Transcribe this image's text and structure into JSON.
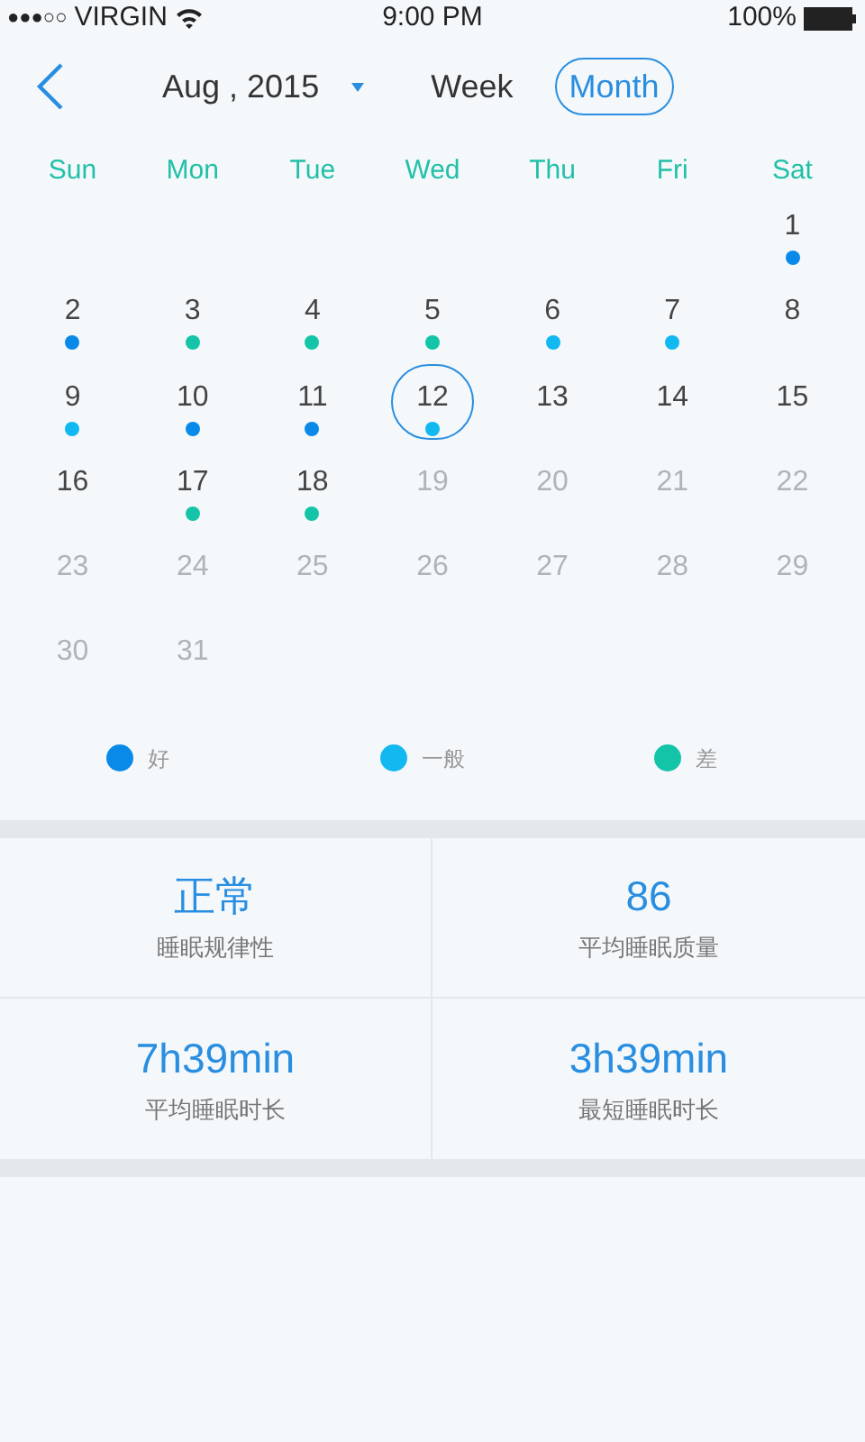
{
  "status_bar": {
    "signal": "●●●○○",
    "carrier": "VIRGIN",
    "time": "9:00 PM",
    "battery": "100%"
  },
  "header": {
    "month": "Aug , 2015",
    "tabs": [
      {
        "label": "Week",
        "selected": false
      },
      {
        "label": "Month",
        "selected": true
      }
    ]
  },
  "weekdays": [
    "Sun",
    "Mon",
    "Tue",
    "Wed",
    "Thu",
    "Fri",
    "Sat"
  ],
  "weeks": [
    [
      {
        "kind": "blank"
      },
      {
        "kind": "blank"
      },
      {
        "kind": "blank"
      },
      {
        "kind": "blank"
      },
      {
        "kind": "blank"
      },
      {
        "kind": "blank"
      },
      {
        "kind": "day",
        "day": "1",
        "muted": false,
        "selected": false,
        "color": "#0a8ae8"
      }
    ],
    [
      {
        "kind": "day",
        "day": "2",
        "muted": false,
        "selected": false,
        "color": "#0a8ae8"
      },
      {
        "kind": "day",
        "day": "3",
        "muted": false,
        "selected": false,
        "color": "#13c4a8"
      },
      {
        "kind": "day",
        "day": "4",
        "muted": false,
        "selected": false,
        "color": "#13c4a8"
      },
      {
        "kind": "day",
        "day": "5",
        "muted": false,
        "selected": false,
        "color": "#13c4a8"
      },
      {
        "kind": "day",
        "day": "6",
        "muted": false,
        "selected": false,
        "color": "#12b8f0"
      },
      {
        "kind": "day",
        "day": "7",
        "muted": false,
        "selected": false,
        "color": "#12b8f0"
      },
      {
        "kind": "day",
        "day": "8",
        "muted": false,
        "selected": false
      }
    ],
    [
      {
        "kind": "day",
        "day": "9",
        "muted": false,
        "selected": false,
        "color": "#12b8f0"
      },
      {
        "kind": "day",
        "day": "10",
        "muted": false,
        "selected": false,
        "color": "#0a8ae8"
      },
      {
        "kind": "day",
        "day": "11",
        "muted": false,
        "selected": false,
        "color": "#0a8ae8"
      },
      {
        "kind": "day",
        "day": "12",
        "muted": false,
        "selected": true,
        "color": "#12b8f0"
      },
      {
        "kind": "day",
        "day": "13",
        "muted": false,
        "selected": false
      },
      {
        "kind": "day",
        "day": "14",
        "muted": false,
        "selected": false
      },
      {
        "kind": "day",
        "day": "15",
        "muted": false,
        "selected": false
      }
    ],
    [
      {
        "kind": "day",
        "day": "16",
        "muted": false,
        "selected": false
      },
      {
        "kind": "day",
        "day": "17",
        "muted": false,
        "selected": false,
        "color": "#13c4a8"
      },
      {
        "kind": "day",
        "day": "18",
        "muted": false,
        "selected": false,
        "color": "#13c4a8"
      },
      {
        "kind": "day",
        "day": "19",
        "muted": true,
        "selected": false
      },
      {
        "kind": "day",
        "day": "20",
        "muted": true,
        "selected": false
      },
      {
        "kind": "day",
        "day": "21",
        "muted": true,
        "selected": false
      },
      {
        "kind": "day",
        "day": "22",
        "muted": true,
        "selected": false
      }
    ],
    [
      {
        "kind": "day",
        "day": "23",
        "muted": true,
        "selected": false
      },
      {
        "kind": "day",
        "day": "24",
        "muted": true,
        "selected": false
      },
      {
        "kind": "day",
        "day": "25",
        "muted": true,
        "selected": false
      },
      {
        "kind": "day",
        "day": "26",
        "muted": true,
        "selected": false
      },
      {
        "kind": "day",
        "day": "27",
        "muted": true,
        "selected": false
      },
      {
        "kind": "day",
        "day": "28",
        "muted": true,
        "selected": false
      },
      {
        "kind": "day",
        "day": "29",
        "muted": true,
        "selected": false
      }
    ],
    [
      {
        "kind": "day",
        "day": "30",
        "muted": true,
        "selected": false
      },
      {
        "kind": "day",
        "day": "31",
        "muted": true,
        "selected": false
      }
    ]
  ],
  "legend": [
    {
      "label": "好",
      "color": "#0a8ae8"
    },
    {
      "label": "一般",
      "color": "#12b8f0"
    },
    {
      "label": "差",
      "color": "#13c4a8"
    }
  ],
  "stats": [
    {
      "value": "正常",
      "label": "睡眠规律性"
    },
    {
      "value": "86",
      "label": "平均睡眠质量"
    },
    {
      "value": "7h39min",
      "label": "平均睡眠时长"
    },
    {
      "value": "3h39min",
      "label": "最短睡眠时长"
    }
  ]
}
